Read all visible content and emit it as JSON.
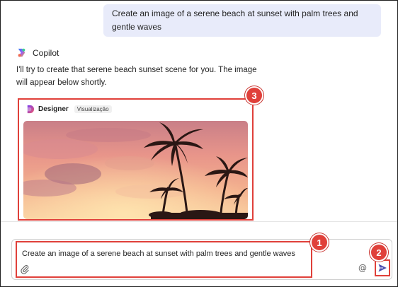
{
  "conversation": {
    "user_message": "Create an image of a serene beach at sunset with palm trees and gentle waves",
    "assistant_name": "Copilot",
    "assistant_reply": "I'll try to create that serene beach sunset scene for you. The image will appear below shortly."
  },
  "designer_card": {
    "name": "Designer",
    "badge": "Visualização",
    "image_alt": "serene beach at sunset with palm trees"
  },
  "composer": {
    "value": "Create an image of a serene beach at sunset with palm trees and gentle waves"
  },
  "callouts": {
    "one": "1",
    "two": "2",
    "three": "3"
  },
  "colors": {
    "accent_red": "#e0403a",
    "user_bubble": "#e8ebfa",
    "send_blue": "#4f52b2"
  },
  "icons": {
    "assistant": "copilot-logo-icon",
    "designer": "designer-logo-icon",
    "attach": "paperclip-icon",
    "mention": "at-sign-icon",
    "send": "send-icon"
  }
}
